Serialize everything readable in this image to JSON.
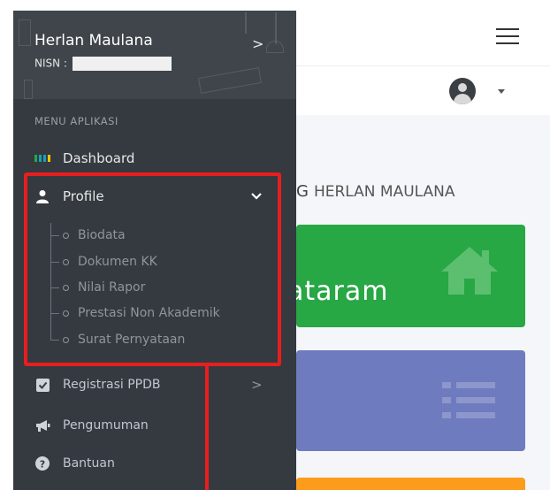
{
  "sidebar": {
    "user_name": "Herlan Maulana",
    "nisn_label": "NISN :",
    "section_title": "MENU APLIKASI",
    "dashboard": "Dashboard",
    "profile": "Profile",
    "profile_submenu": [
      "Biodata",
      "Dokumen KK",
      "Nilai Rapor",
      "Prestasi Non Akademik",
      "Surat Pernyataan"
    ],
    "registrasi": "Registrasi PPDB",
    "pengumuman": "Pengumuman",
    "bantuan": "Bantuan",
    "highlight_color": "#e81e1e"
  },
  "main": {
    "welcome_text": "HERLAN MAULANA",
    "welcome_fragment": "G",
    "card_green_text": "ataram",
    "colors": {
      "green": "#28a745",
      "purple": "#6f7bbf",
      "orange": "#fd9b1c"
    }
  },
  "icons": {
    "header_chevron": "chevron-right-icon",
    "dashboard": "dashboard-grid-icon",
    "profile": "user-icon",
    "profile_arrow": "chevron-down-icon",
    "registrasi": "check-square-icon",
    "registrasi_arrow": "chevron-right-icon",
    "pengumuman": "bullhorn-icon",
    "bantuan": "question-circle-icon",
    "hamburger": "hamburger-menu-icon",
    "avatar": "user-avatar-icon",
    "house": "home-icon",
    "list": "list-icon"
  }
}
